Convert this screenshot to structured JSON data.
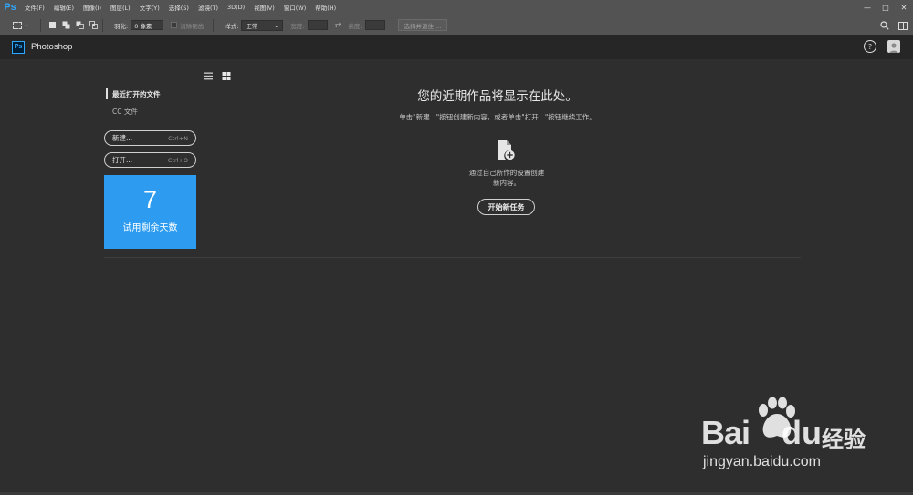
{
  "menubar": {
    "app_logo": "Ps",
    "items": [
      "文件(F)",
      "编辑(E)",
      "图像(I)",
      "图层(L)",
      "文字(Y)",
      "选择(S)",
      "滤镜(T)",
      "3D(D)",
      "视图(V)",
      "窗口(W)",
      "帮助(H)"
    ],
    "window_controls": [
      "—",
      "□",
      "✕"
    ]
  },
  "optbar": {
    "feather_label": "羽化:",
    "feather_value": "0 像素",
    "antialias_label": "消除锯齿",
    "style_label": "样式:",
    "style_value": "正常",
    "width_label": "宽度:",
    "height_label": "高度:",
    "select_mask_button": "选择并遮住 ..."
  },
  "header": {
    "badge": "Ps",
    "app_name": "Photoshop",
    "help": "?"
  },
  "sidebar": {
    "recent_title": "最近打开的文件",
    "cc_files": "CC 文件",
    "new_button": {
      "label": "新建...",
      "shortcut": "Ctrl+N"
    },
    "open_button": {
      "label": "打开...",
      "shortcut": "Ctrl+O"
    },
    "trial": {
      "days": "7",
      "label": "试用剩余天数"
    }
  },
  "main": {
    "headline": "您的近期作品将显示在此处。",
    "subline": "单击\"新建...\"按钮创建新内容，或者单击\"打开...\"按钮继续工作。",
    "desc_line1": "通过自己所作的设置创建",
    "desc_line2": "新内容。",
    "start_button": "开始新任务"
  },
  "watermark": {
    "bai": "Bai",
    "du": "du",
    "jingyan": "经验",
    "url": "jingyan.baidu.com"
  },
  "colors": {
    "accent": "#31a8ff",
    "trial_card": "#2d9cf0",
    "workspace_bg": "#2e2e2e",
    "header_bg": "#262626",
    "menubar_bg": "#535353"
  }
}
